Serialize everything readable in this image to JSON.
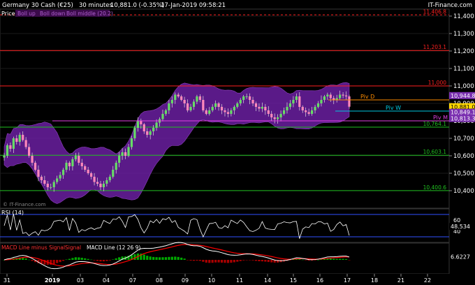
{
  "header": {
    "instrument": "Germany 30 Cash (€25)",
    "timeframe": "30 minutes",
    "last": "10,881.0 (-0.35%)",
    "datetime": "17-Jan-2019 09:58:21",
    "brand": "IT-Finance.com"
  },
  "price_panel": {
    "label": "Price",
    "legend": [
      "Boll up",
      "Boll down",
      "Boll middle (20.2)"
    ],
    "watermark": "© IT-Finance.com"
  },
  "rsi_panel": {
    "label": "RSI (14)",
    "value_label": "48.534"
  },
  "macd_panel": {
    "label_a": "MACD Line minus Signal",
    "label_b": "Signal",
    "label_c": "MACD Line (12 26 9)",
    "value_label": "6.6227"
  },
  "colors": {
    "background": "#000000",
    "candle_up": "#66dd66",
    "candle_down": "#ff88bb",
    "bollinger_band": "#6a1fa0",
    "resistance": "#ff2020",
    "support": "#20c020",
    "pivot_d": "#ff8c00",
    "pivot_w": "#00c8e0",
    "pivot_m": "#e040e0",
    "rsi_line": "#ffffff",
    "macd_line": "#ffffff",
    "signal_line": "#ff0000",
    "hist_pos": "#00aa00",
    "hist_neg": "#aa0000"
  },
  "chart_data": {
    "type": "candlestick",
    "y_ticks": [
      "11,400",
      "11,300",
      "11,200",
      "11,100",
      "11,000",
      "10,900",
      "10,800",
      "10,700",
      "10,600",
      "10,500",
      "10,400"
    ],
    "x_ticks": [
      "31",
      "2019",
      "03",
      "04",
      "07",
      "08",
      "09",
      "10",
      "11",
      "14",
      "15",
      "16",
      "17",
      "18",
      "21",
      "22"
    ],
    "price_range": [
      10300,
      11440
    ],
    "horizontal_levels": [
      {
        "label": "11,406.8",
        "value": 11406.8,
        "color": "#ff2020",
        "dashed": true
      },
      {
        "label": "11,203.1",
        "value": 11203.1,
        "color": "#ff2020",
        "dashed": false
      },
      {
        "label": "11,000",
        "value": 11000,
        "color": "#ff2020",
        "dashed": false
      },
      {
        "label": "10,764.1",
        "value": 10764.1,
        "color": "#20c020",
        "dashed": false
      },
      {
        "label": "10,603.1",
        "value": 10603.1,
        "color": "#20c020",
        "dashed": false
      },
      {
        "label": "10,400.6",
        "value": 10400.6,
        "color": "#20c020",
        "dashed": false
      }
    ],
    "pivots": [
      {
        "label": "Piv D",
        "value": 10920,
        "color": "#ff8c00"
      },
      {
        "label": "Piv W",
        "value": 10856,
        "color": "#00c8e0"
      },
      {
        "label": "Piv M",
        "value": 10800,
        "color": "#e040e0"
      }
    ],
    "right_price_tags": [
      {
        "label": "10,944.8",
        "value": 10944.8,
        "bg": "#7a2fb0",
        "fg": "#ffffff"
      },
      {
        "label": "10,881.0",
        "value": 10881.0,
        "bg": "#ffd700",
        "fg": "#000000"
      },
      {
        "label": "10,849.1",
        "value": 10849.1,
        "bg": "#7a2fb0",
        "fg": "#ffffff"
      },
      {
        "label": "10,813.3",
        "value": 10813.3,
        "bg": "#7a2fb0",
        "fg": "#ffffff"
      }
    ],
    "close_path": [
      10600,
      10660,
      10640,
      10700,
      10680,
      10720,
      10690,
      10650,
      10600,
      10560,
      10520,
      10480,
      10460,
      10440,
      10420,
      10420,
      10450,
      10470,
      10490,
      10520,
      10560,
      10540,
      10580,
      10600,
      10560,
      10540,
      10520,
      10500,
      10480,
      10450,
      10440,
      10420,
      10440,
      10460,
      10480,
      10520,
      10560,
      10600,
      10620,
      10600,
      10650,
      10700,
      10760,
      10800,
      10780,
      10740,
      10720,
      10740,
      10760,
      10790,
      10810,
      10840,
      10860,
      10900,
      10920,
      10950,
      10940,
      10920,
      10900,
      10860,
      10880,
      10910,
      10940,
      10920,
      10860,
      10840,
      10860,
      10880,
      10900,
      10880,
      10860,
      10850,
      10840,
      10860,
      10880,
      10900,
      10920,
      10940,
      10940,
      10920,
      10900,
      10880,
      10870,
      10880,
      10860,
      10840,
      10820,
      10810,
      10820,
      10840,
      10860,
      10880,
      10900,
      10920,
      10940,
      10880,
      10860,
      10850,
      10840,
      10860,
      10880,
      10900,
      10920,
      10940,
      10950,
      10930,
      10920,
      10930,
      10950,
      10945,
      10940,
      10881
    ],
    "rsi": {
      "range": [
        20,
        80
      ],
      "ticks": [
        "60",
        "40"
      ],
      "levels": [
        70,
        30
      ]
    },
    "macd": {
      "range": [
        -30,
        30
      ]
    }
  }
}
